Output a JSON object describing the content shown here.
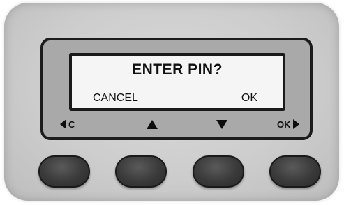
{
  "screen": {
    "title": "ENTER PIN?",
    "left_softkey": "CANCEL",
    "right_softkey": "OK"
  },
  "key_legends": {
    "cancel_key": "C",
    "ok_key": "OK",
    "up_icon": "up-arrow",
    "down_icon": "down-arrow",
    "left_icon": "left-arrow",
    "right_icon": "right-arrow"
  },
  "colors": {
    "device_body": "#cdcdcd",
    "bezel": "#a9a9a9",
    "screen_bg": "#f5f5f5",
    "button": "#3a3a3a",
    "text": "#111111"
  }
}
